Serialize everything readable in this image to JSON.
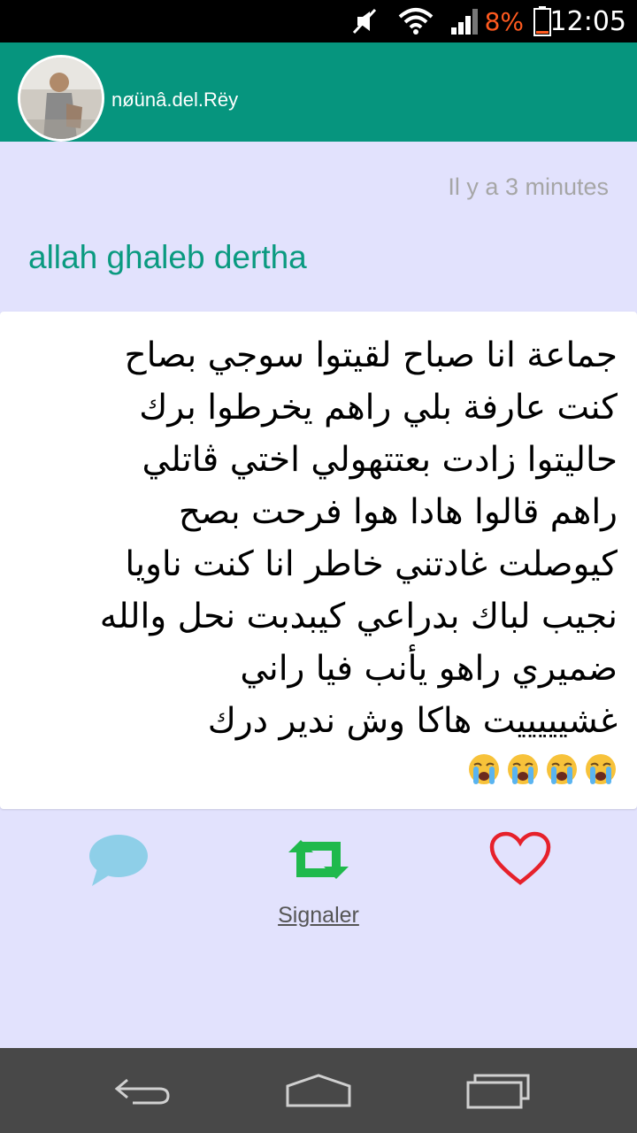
{
  "status_bar": {
    "time": "12:05",
    "battery_percent": "8%",
    "icons": [
      "mute-icon",
      "wifi-icon",
      "signal-icon",
      "battery-icon"
    ]
  },
  "header": {
    "username": "nøünâ.del.Rëy",
    "accent_color": "#06957e"
  },
  "post": {
    "timestamp": "Il y a 3 minutes",
    "title": "allah ghaleb dertha",
    "body": "جماعة انا صباح لقيتوا سوجي بصاح\nكنت عارفة بلي راهم يخرطوا برك\nحاليتوا زادت بعتتهولي اختي ڨاتلي\nراهم قالوا هادا هوا فرحت بصح\nكيوصلت غادتني خاطر انا كنت ناويا\nنجيب لباك بدراعي كيبدبت نحل والله\nضميري راهو يأنب فيا راني\nغشيييييت هاكا وش ندير درك",
    "emoji_count": 4,
    "emoji": "crying-face-icon"
  },
  "actions": {
    "comment_icon": "comment-bubble-icon",
    "repost_icon": "repost-icon",
    "like_icon": "heart-icon",
    "report_label": "Signaler",
    "colors": {
      "comment": "#8ecfe8",
      "repost": "#1fb94c",
      "like": "#e6212b"
    }
  },
  "nav_bar": {
    "buttons": [
      "back-icon",
      "home-icon",
      "recents-icon"
    ]
  }
}
